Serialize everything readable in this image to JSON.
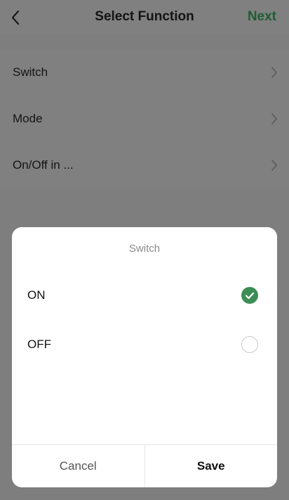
{
  "header": {
    "title": "Select Function",
    "next_label": "Next",
    "back_icon": "chevron-left-icon",
    "next_color": "#1d5f31"
  },
  "functions": [
    {
      "label": "Switch"
    },
    {
      "label": "Mode"
    },
    {
      "label": "On/Off in ..."
    }
  ],
  "dialog": {
    "title": "Switch",
    "options": [
      {
        "label": "ON",
        "selected": true
      },
      {
        "label": "OFF",
        "selected": false
      }
    ],
    "cancel_label": "Cancel",
    "save_label": "Save",
    "accent_color": "#3c8d56"
  }
}
